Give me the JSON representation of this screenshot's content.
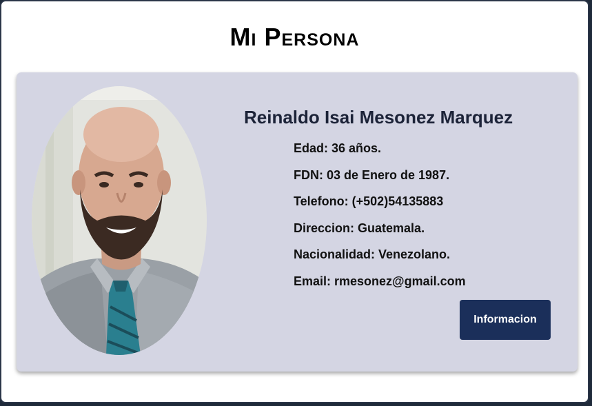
{
  "page": {
    "title": "Mi Persona"
  },
  "profile": {
    "name": "Reinaldo Isai Mesonez Marquez",
    "details": [
      "Edad: 36 años.",
      "FDN: 03 de Enero de 1987.",
      "Telefono: (+502)54135883",
      "Direccion: Guatemala.",
      "Nacionalidad: Venezolano.",
      "Email: rmesonez@gmail.com"
    ],
    "button_label": "Informacion",
    "photo_icon": "profile-photo"
  },
  "colors": {
    "card_background": "#d4d5e3",
    "button_background": "#1b2f5a",
    "name_color": "#1c2338"
  }
}
